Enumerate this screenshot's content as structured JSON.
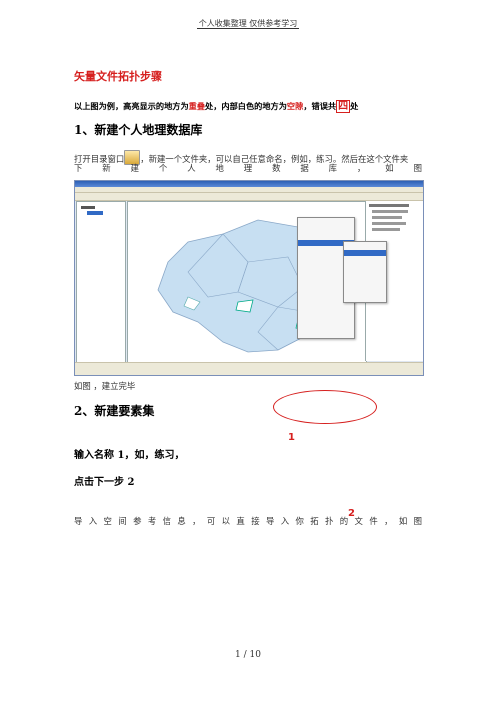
{
  "header": {
    "text": "个人收集整理    仅供参考学习"
  },
  "title": "矢量文件拓扑步骤",
  "intro": {
    "part1": "以上图为例，高亮显示的地方为",
    "highlight1": "重叠",
    "part2": "处，内部白色的地方为",
    "highlight2": "空隙",
    "part3": "，错误共",
    "boxed": "四",
    "part4": "处"
  },
  "section1": {
    "heading": "1、新建个人地理数据库",
    "line1_a": "打开目录窗口",
    "line1_b": "，新建一个文件夹，可以自己任意命名，例如，练习。然后在这个文件夹",
    "line2_chars": [
      "下",
      "新",
      "建",
      "个",
      "人",
      "地",
      "理",
      "数",
      "据",
      "库",
      "，",
      "如",
      "图"
    ],
    "caption": "如图 ，建立完毕"
  },
  "section2": {
    "heading": "2、新建要素集",
    "step1": "输入名称 1，如，练习，",
    "step2": "点击下一步 2",
    "line_chars": [
      "导",
      "入",
      "空",
      "间",
      "参",
      "考",
      "信",
      "息",
      "，",
      "可",
      "以",
      "直",
      "接",
      "导",
      "入",
      "你",
      "拓",
      "扑",
      "的",
      "文",
      "件",
      "，",
      "如",
      "图"
    ],
    "mark1": "1",
    "mark2": "2"
  },
  "footer": {
    "text": "1 / 10"
  },
  "colors": {
    "accent": "#d6201f",
    "selection": "#316ac5"
  },
  "icons": [
    "catalog-window-icon"
  ]
}
